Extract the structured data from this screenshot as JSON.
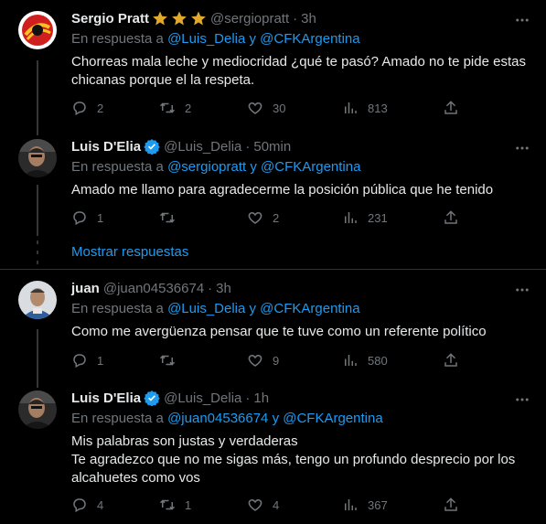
{
  "colors": {
    "accent": "#1d9bf0",
    "muted": "#71767b",
    "text": "#e7e9ea",
    "gold": "#e2a92c",
    "background": "#000000"
  },
  "tweets": [
    {
      "name": "Sergio Pratt",
      "badges": [
        "star-icon",
        "star-icon",
        "star-icon"
      ],
      "handle": "@sergiopratt",
      "time": "3h",
      "reply_prefix": "En respuesta a",
      "reply_to": "@Luis_Delia y @CFKArgentina",
      "text": "Chorreas mala leche y mediocridad ¿qué te pasó? Amado no te pide estas chicanas porque el la respeta.",
      "replies": "2",
      "retweets": "2",
      "likes": "30",
      "views": "813"
    },
    {
      "name": "Luis D'Elia",
      "badges": [
        "verified-badge-icon"
      ],
      "handle": "@Luis_Delia",
      "time": "50min",
      "reply_prefix": "En respuesta a",
      "reply_to": "@sergiopratt y @CFKArgentina",
      "text": "Amado me llamo para agradecerme la posición pública que he tenido",
      "replies": "1",
      "retweets": "",
      "likes": "2",
      "views": "231"
    },
    {
      "name": "juan",
      "badges": [],
      "handle": "@juan04536674",
      "time": "3h",
      "reply_prefix": "En respuesta a",
      "reply_to": "@Luis_Delia y @CFKArgentina",
      "text": "Como me avergüenza pensar que te tuve como un referente político",
      "replies": "1",
      "retweets": "",
      "likes": "9",
      "views": "580"
    },
    {
      "name": "Luis D'Elia",
      "badges": [
        "verified-badge-icon"
      ],
      "handle": "@Luis_Delia",
      "time": "1h",
      "reply_prefix": "En respuesta a",
      "reply_to": "@juan04536674 y @CFKArgentina",
      "text_lines": [
        "Mis palabras son justas y verdaderas",
        "Te agradezco que no me sigas más, tengo un profundo desprecio por los alcahuetes como vos"
      ],
      "replies": "4",
      "retweets": "1",
      "likes": "4",
      "views": "367"
    }
  ],
  "show_replies_label": "Mostrar respuestas",
  "separator_dot": "·"
}
